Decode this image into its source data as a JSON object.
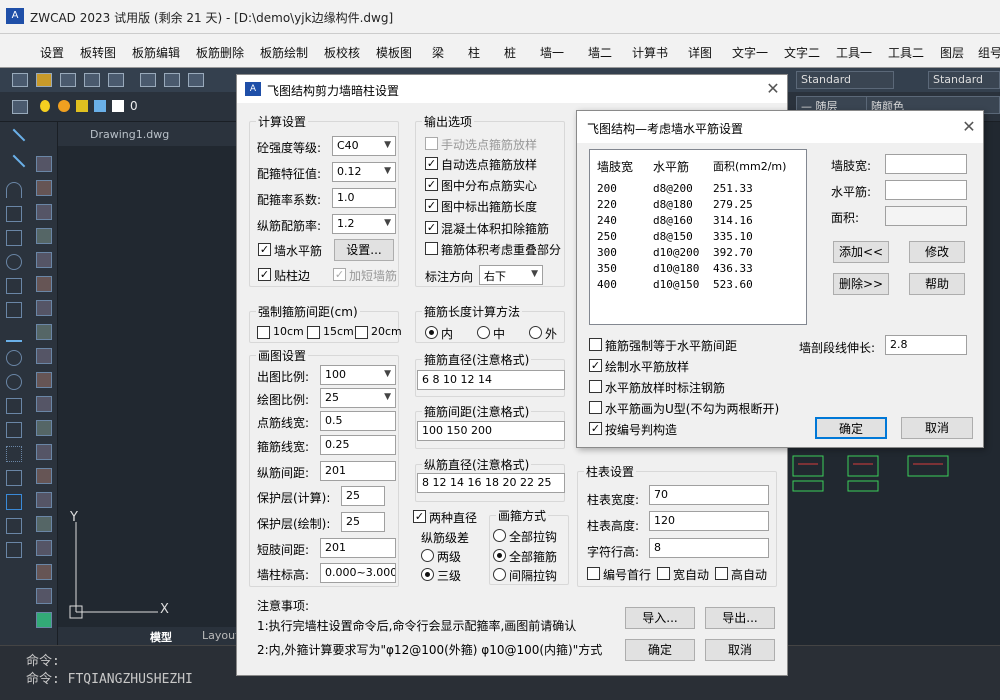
{
  "app": {
    "title": "ZWCAD 2023 试用版 (剩余 21 天) - [D:\\demo\\yjk边缘构件.dwg]",
    "icon": "A"
  },
  "menu": [
    "设置",
    "板转图",
    "板筋编辑",
    "板筋删除",
    "板筋绘制",
    "板校核",
    "模板图",
    "梁",
    "柱",
    "桩",
    "墙一",
    "墙二",
    "计算书",
    "详图",
    "文字一",
    "文字二",
    "工具一",
    "工具二",
    "图层",
    "组号"
  ],
  "toolbar": {
    "style1": "Standard",
    "style2": "Standard",
    "layer_value": "0",
    "linetype": "— 随层",
    "color": "随颜色"
  },
  "drawing_tab": "Drawing1.dwg",
  "bottom_tabs": {
    "model": "模型",
    "layout": "Layout"
  },
  "axes": {
    "y": "Y",
    "x": "X"
  },
  "command": {
    "line1": "命令:",
    "line2": "命令: FTQIANGZHUSHEZHI"
  },
  "main_dialog": {
    "title": "飞图结构剪力墙暗柱设置",
    "calc": {
      "title": "计算设置",
      "concrete_label": "砼强度等级:",
      "concrete_value": "C40",
      "stirrup_char_label": "配箍特征值:",
      "stirrup_char_value": "0.12",
      "stirrup_ratio_label": "配箍率系数:",
      "stirrup_ratio_value": "1.0",
      "long_ratio_label": "纵筋配筋率:",
      "long_ratio_value": "1.2",
      "wall_horiz_label": "墙水平筋",
      "settings_btn": "设置...",
      "stick_edge_label": "贴柱边",
      "short_wall_label": "加短墙筋"
    },
    "output": {
      "title": "输出选项",
      "opt1": "手动选点箍筋放样",
      "opt2": "自动选点箍筋放样",
      "opt3": "图中分布点筋实心",
      "opt4": "图中标出箍筋长度",
      "opt5": "混凝土体积扣除箍筋",
      "opt6": "箍筋体积考虑重叠部分",
      "dir_label": "标注方向",
      "dir_value": "右下"
    },
    "force_spacing": {
      "title": "强制箍筋间距(cm)",
      "o1": "10cm",
      "o2": "15cm",
      "o3": "20cm"
    },
    "stirrup_len": {
      "title": "箍筋长度计算方法",
      "r1": "内",
      "r2": "中",
      "r3": "外"
    },
    "drawing": {
      "title": "画图设置",
      "out_scale_label": "出图比例:",
      "out_scale_value": "100",
      "draw_scale_label": "绘图比例:",
      "draw_scale_value": "25",
      "dot_width_label": "点筋线宽:",
      "dot_width_value": "0.5",
      "stir_width_label": "箍筋线宽:",
      "stir_width_value": "0.25",
      "long_spacing_label": "纵筋间距:",
      "long_spacing_value": "201",
      "cover_calc_label": "保护层(计算):",
      "cover_calc_value": "25",
      "cover_draw_label": "保护层(绘制):",
      "cover_draw_value": "25",
      "short_spacing_label": "短肢间距:",
      "short_spacing_value": "201",
      "elev_label": "墙柱标高:",
      "elev_value": "0.000~3.000"
    },
    "stir_dia": {
      "title": "箍筋直径(注意格式)",
      "value": "6 8 10 12 14"
    },
    "stir_spacing": {
      "title": "箍筋间距(注意格式)",
      "value": "100 150 200"
    },
    "long_dia": {
      "title": "纵筋直径(注意格式)",
      "value": "8 12 14 16 18 20 22 25"
    },
    "two_dia": "两种直径",
    "long_grade": {
      "title": "纵筋级差",
      "r1": "两级",
      "r2": "三级"
    },
    "stir_mode": {
      "title": "画箍方式",
      "r1": "全部拉钩",
      "r2": "全部箍筋",
      "r3": "间隔拉钩"
    },
    "col_table": {
      "title": "柱表设置",
      "width_label": "柱表宽度:",
      "width_value": "70",
      "height_label": "柱表高度:",
      "height_value": "120",
      "row_label": "字符行高:",
      "row_value": "8",
      "c1": "编号首行",
      "c2": "宽自动",
      "c3": "高自动"
    },
    "notes": {
      "title": "注意事项:",
      "l1": "1:执行完墙柱设置命令后,命令行会显示配箍率,画图前请确认",
      "l2": "2:内,外箍计算要求写为\"φ12@100(外箍) φ10@100(内箍)\"方式"
    },
    "import_btn": "导入...",
    "export_btn": "导出...",
    "ok_btn": "确定",
    "cancel_btn": "取消"
  },
  "sub_dialog": {
    "title": "飞图结构—考虑墙水平筋设置",
    "headers": [
      "墙肢宽",
      "水平筋",
      "面积(mm2/m)"
    ],
    "rows": [
      [
        "200",
        "d8@200",
        "251.33"
      ],
      [
        "220",
        "d8@180",
        "279.25"
      ],
      [
        "240",
        "d8@160",
        "314.16"
      ],
      [
        "250",
        "d8@150",
        "335.10"
      ],
      [
        "300",
        "d10@200",
        "392.70"
      ],
      [
        "350",
        "d10@180",
        "436.33"
      ],
      [
        "400",
        "d10@150",
        "523.60"
      ]
    ],
    "limb_label": "墙肢宽:",
    "horiz_label": "水平筋:",
    "area_label": "面积:",
    "add_btn": "添加<<",
    "modify_btn": "修改",
    "delete_btn": "删除>>",
    "help_btn": "帮助",
    "c1": "箍筋强制等于水平筋间距",
    "c2": "绘制水平筋放样",
    "c3": "水平筋放样时标注钢筋",
    "c4": "水平筋画为U型(不勾为两根断开)",
    "c5": "按编号判构造",
    "ext_label": "墙剖段线伸长:",
    "ext_value": "2.8",
    "ok_btn": "确定",
    "cancel_btn": "取消"
  }
}
